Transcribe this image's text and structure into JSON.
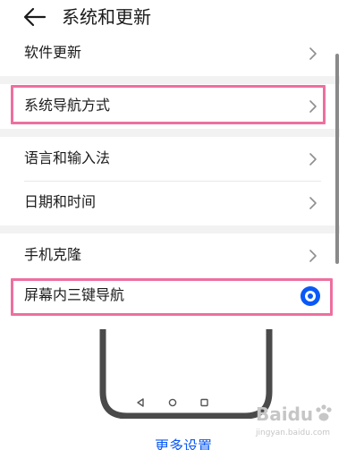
{
  "header": {
    "title": "系统和更新",
    "back_icon": "back-arrow-icon"
  },
  "rows": [
    {
      "label": "软件更新"
    },
    {
      "label": "系统导航方式"
    },
    {
      "label": "语言和输入法"
    },
    {
      "label": "日期和时间"
    },
    {
      "label": "手机克隆"
    },
    {
      "label": "屏幕内三键导航",
      "selected": true
    }
  ],
  "more_settings": "更多设置",
  "watermark": {
    "text": "Baidu",
    "sub": "jingyan.baidu.com"
  },
  "colors": {
    "accent": "#0a59f7",
    "highlight": "#ee6fa0",
    "section_gap": "#f2f2f2"
  }
}
